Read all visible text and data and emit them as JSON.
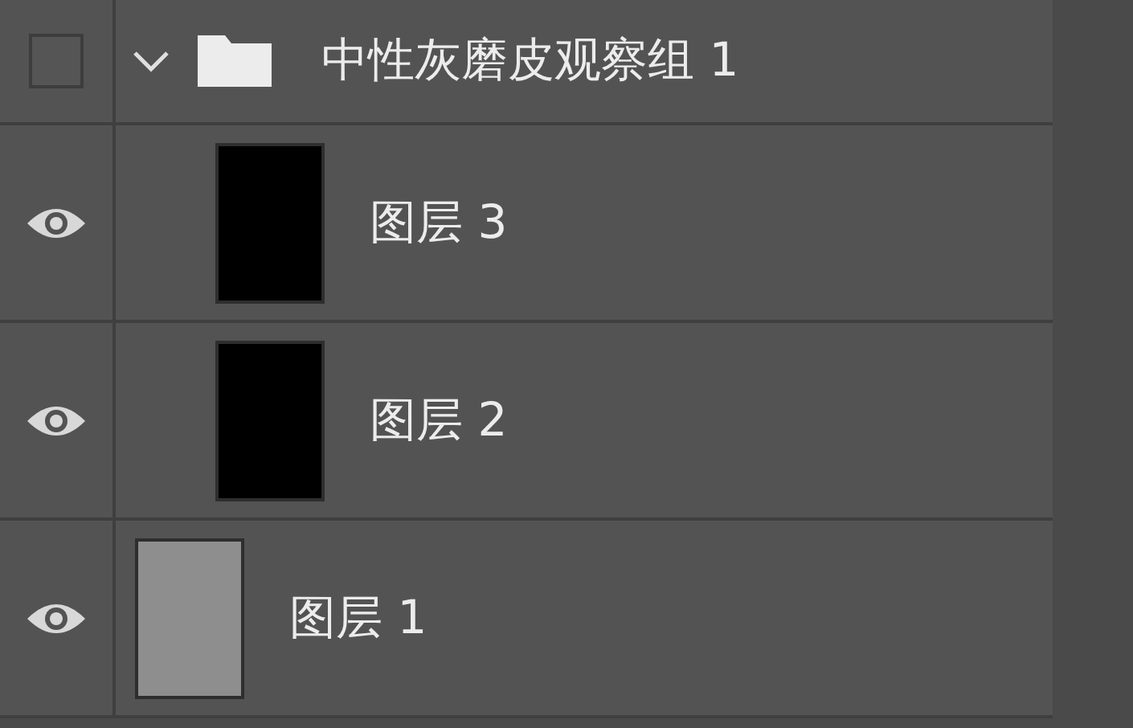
{
  "group": {
    "name": "中性灰磨皮观察组 1",
    "expanded": true,
    "visible": false,
    "children": [
      {
        "name": "图层 3",
        "visible": true,
        "color": "#000000"
      },
      {
        "name": "图层 2",
        "visible": true,
        "color": "#000000"
      }
    ]
  },
  "layers": [
    {
      "name": "图层 1",
      "visible": true,
      "color": "#8e8e8e"
    }
  ]
}
